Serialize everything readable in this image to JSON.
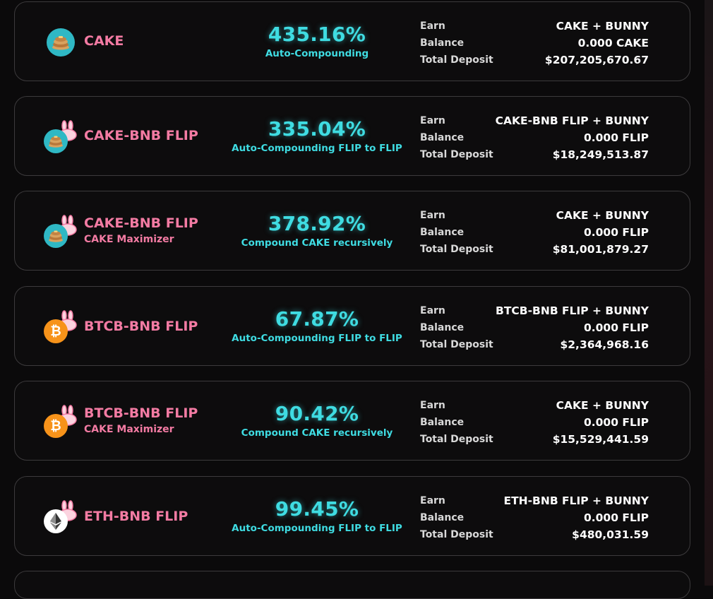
{
  "labels": {
    "earn": "Earn",
    "balance": "Balance",
    "total_deposit": "Total Deposit"
  },
  "colors": {
    "background": "#0b0a0b",
    "card_border": "#3c3a3c",
    "pool_name": "#f37ba3",
    "apy": "#3fdce2",
    "value": "#ffffff"
  },
  "pools": [
    {
      "name": "CAKE",
      "subtitle": "",
      "icon": "cake-icon",
      "apy": "435.16%",
      "apy_desc": "Auto-Compounding",
      "earn": "CAKE + BUNNY",
      "balance": "0.000 CAKE",
      "total_deposit": "$207,205,670.67"
    },
    {
      "name": "CAKE-BNB FLIP",
      "subtitle": "",
      "icon": "cake-icon",
      "apy": "335.04%",
      "apy_desc": "Auto-Compounding FLIP to FLIP",
      "earn": "CAKE-BNB FLIP + BUNNY",
      "balance": "0.000 FLIP",
      "total_deposit": "$18,249,513.87"
    },
    {
      "name": "CAKE-BNB FLIP",
      "subtitle": "CAKE Maximizer",
      "icon": "cake-icon",
      "apy": "378.92%",
      "apy_desc": "Compound CAKE recursively",
      "earn": "CAKE + BUNNY",
      "balance": "0.000 FLIP",
      "total_deposit": "$81,001,879.27"
    },
    {
      "name": "BTCB-BNB FLIP",
      "subtitle": "",
      "icon": "bitcoin-icon",
      "apy": "67.87%",
      "apy_desc": "Auto-Compounding FLIP to FLIP",
      "earn": "BTCB-BNB FLIP + BUNNY",
      "balance": "0.000 FLIP",
      "total_deposit": "$2,364,968.16"
    },
    {
      "name": "BTCB-BNB FLIP",
      "subtitle": "CAKE Maximizer",
      "icon": "bitcoin-icon",
      "apy": "90.42%",
      "apy_desc": "Compound CAKE recursively",
      "earn": "CAKE + BUNNY",
      "balance": "0.000 FLIP",
      "total_deposit": "$15,529,441.59"
    },
    {
      "name": "ETH-BNB FLIP",
      "subtitle": "",
      "icon": "ethereum-icon",
      "apy": "99.45%",
      "apy_desc": "Auto-Compounding FLIP to FLIP",
      "earn": "ETH-BNB FLIP + BUNNY",
      "balance": "0.000 FLIP",
      "total_deposit": "$480,031.59"
    }
  ]
}
